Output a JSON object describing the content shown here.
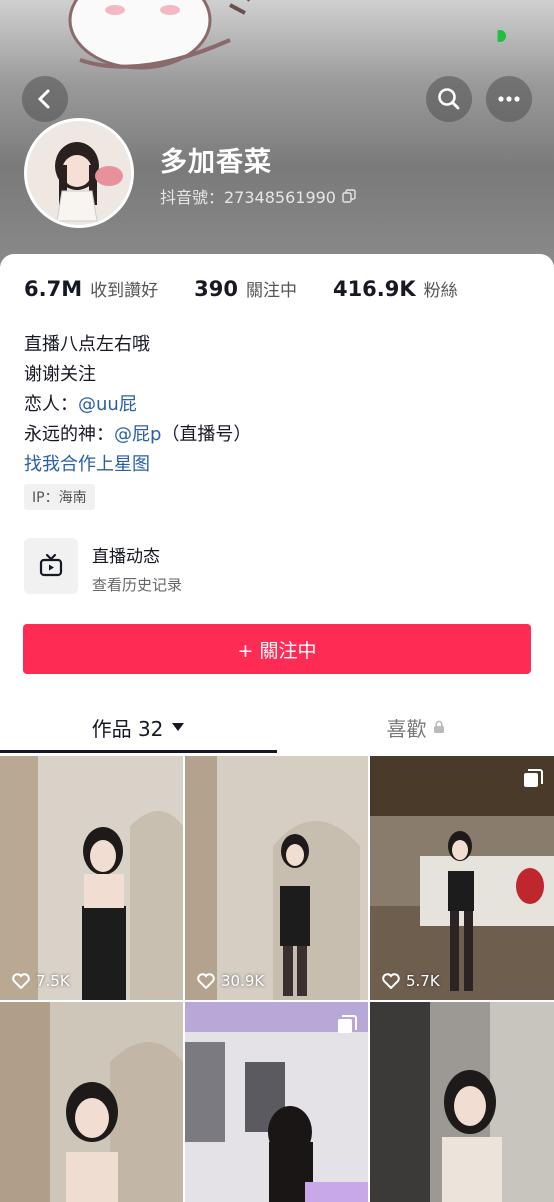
{
  "profile": {
    "nickname": "多加香菜",
    "douyin_id": "抖音號：27348561990"
  },
  "stats": [
    {
      "value": "6.7M",
      "label": "收到讚好"
    },
    {
      "value": "390",
      "label": "關注中"
    },
    {
      "value": "416.9K",
      "label": "粉絲"
    }
  ],
  "bio": {
    "line1": "直播八点左右哦",
    "line2": "谢谢关注",
    "line3_prefix": "恋人：",
    "line3_link": "@uu屁",
    "line4_prefix": "永远的神：",
    "line4_link": "@屁p",
    "line4_suffix": "（直播号）",
    "line5_link": "找我合作上星图"
  },
  "ip_tag": "IP：海南",
  "live": {
    "title": "直播动态",
    "subtitle": "查看历史记录"
  },
  "follow_button": "+ 關注中",
  "tabs": {
    "works": "作品 32",
    "likes": "喜歡"
  },
  "videos": [
    {
      "likes": "7.5K"
    },
    {
      "likes": "30.9K"
    },
    {
      "likes": "5.7K"
    },
    {
      "likes": ""
    },
    {
      "likes": ""
    },
    {
      "likes": ""
    }
  ],
  "icons": [
    "back-arrow-icon",
    "search-icon",
    "more-icon",
    "copy-icon",
    "tv-icon",
    "dropdown-caret-icon",
    "lock-icon",
    "heart-icon",
    "multi-image-icon"
  ],
  "colors": {
    "accent": "#fe2c55",
    "link": "#2a5fa8",
    "status_green": "#1fbf3f"
  }
}
